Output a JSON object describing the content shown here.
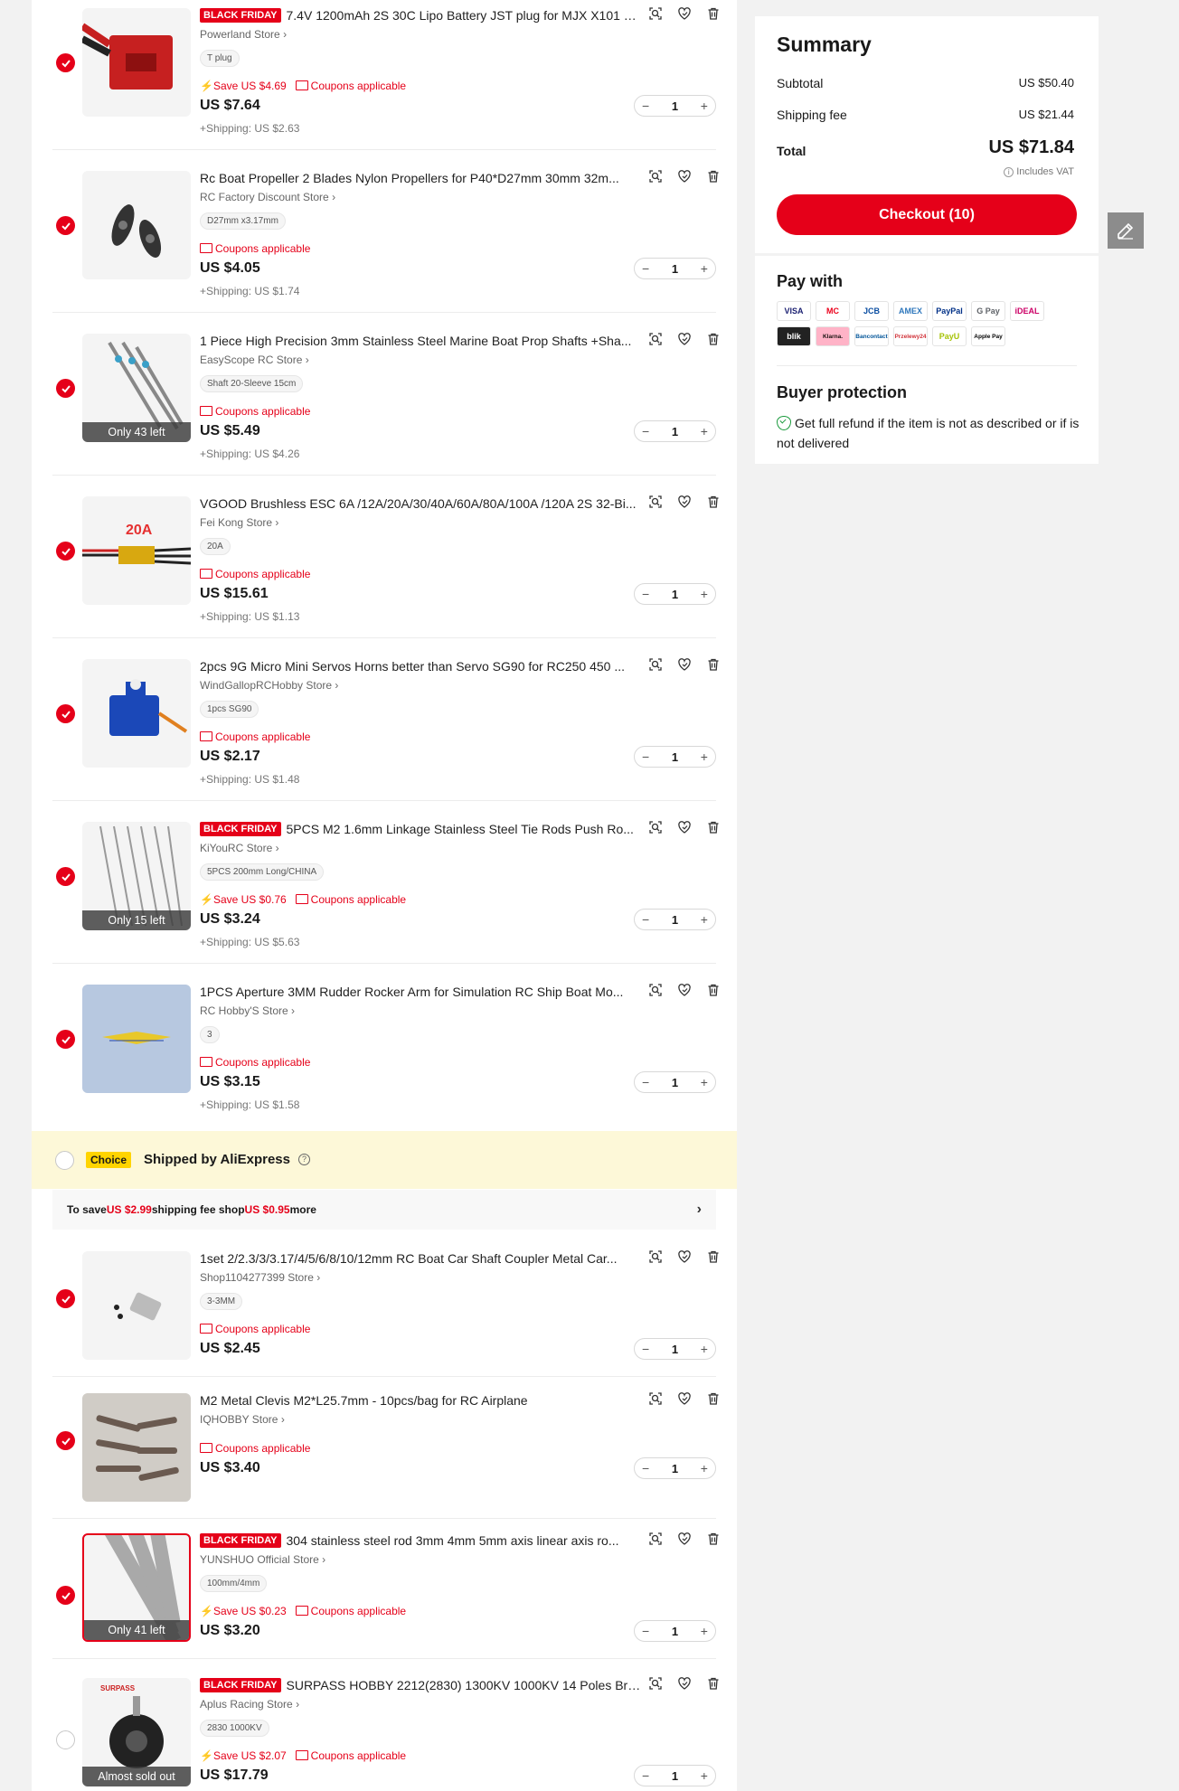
{
  "items": [
    {
      "badge": "BLACK FRIDAY",
      "title": "7.4V 1200mAh 2S 30C Lipo Battery JST plug for MJX X101 X...",
      "store": "Powerland Store",
      "variant": "T plug",
      "save": "Save US $4.69",
      "coupon": "Coupons applicable",
      "price": "US $7.64",
      "shipping": "+Shipping: US $2.63",
      "qty": "1",
      "stock": ""
    },
    {
      "badge": "",
      "title": "Rc Boat Propeller 2 Blades Nylon Propellers for P40*D27mm 30mm 32m...",
      "store": "RC Factory Discount Store",
      "variant": "D27mm x3.17mm",
      "save": "",
      "coupon": "Coupons applicable",
      "price": "US $4.05",
      "shipping": "+Shipping: US $1.74",
      "qty": "1",
      "stock": ""
    },
    {
      "badge": "",
      "title": "1 Piece High Precision 3mm Stainless Steel Marine Boat Prop Shafts +Sha...",
      "store": "EasyScope RC Store",
      "variant": "Shaft 20-Sleeve 15cm",
      "save": "",
      "coupon": "Coupons applicable",
      "price": "US $5.49",
      "shipping": "+Shipping: US $4.26",
      "qty": "1",
      "stock": "Only 43 left"
    },
    {
      "badge": "",
      "title": "VGOOD Brushless ESC 6A /12A/20A/30/40A/60A/80A/100A /120A 2S 32-Bi...",
      "store": "Fei Kong Store",
      "variant": "20A",
      "save": "",
      "coupon": "Coupons applicable",
      "price": "US $15.61",
      "shipping": "+Shipping: US $1.13",
      "qty": "1",
      "stock": ""
    },
    {
      "badge": "",
      "title": "2pcs 9G Micro Mini Servos Horns better than Servo SG90 for RC250 450 ...",
      "store": "WindGallopRCHobby Store",
      "variant": "1pcs SG90",
      "save": "",
      "coupon": "Coupons applicable",
      "price": "US $2.17",
      "shipping": "+Shipping: US $1.48",
      "qty": "1",
      "stock": ""
    },
    {
      "badge": "BLACK FRIDAY",
      "title": "5PCS M2 1.6mm Linkage Stainless Steel Tie Rods Push Ro...",
      "store": "KiYouRC Store",
      "variant": "5PCS 200mm Long/CHINA",
      "save": "Save US $0.76",
      "coupon": "Coupons applicable",
      "price": "US $3.24",
      "shipping": "+Shipping: US $5.63",
      "qty": "1",
      "stock": "Only 15 left"
    },
    {
      "badge": "",
      "title": "1PCS Aperture 3MM Rudder Rocker Arm for Simulation RC Ship Boat Mo...",
      "store": "RC Hobby'S Store",
      "variant": "3",
      "save": "",
      "coupon": "Coupons applicable",
      "price": "US $3.15",
      "shipping": "+Shipping: US $1.58",
      "qty": "1",
      "stock": ""
    }
  ],
  "choice": {
    "badge": "Choice",
    "label": "Shipped by AliExpress",
    "save_prefix": "To save ",
    "save_amount": "US $2.99",
    "save_middle": " shipping fee shop ",
    "save_more": "US $0.95",
    "save_suffix": " more"
  },
  "items2": [
    {
      "badge": "",
      "title": "1set 2/2.3/3/3.17/4/5/6/8/10/12mm RC Boat Car Shaft Coupler Metal Car...",
      "store": "Shop1104277399 Store",
      "variant": "3-3MM",
      "save": "",
      "coupon": "Coupons applicable",
      "price": "US $2.45",
      "shipping": "",
      "qty": "1",
      "stock": ""
    },
    {
      "badge": "",
      "title": "M2 Metal Clevis M2*L25.7mm - 10pcs/bag for RC Airplane",
      "store": "IQHOBBY Store",
      "variant": "",
      "save": "",
      "coupon": "Coupons applicable",
      "price": "US $3.40",
      "shipping": "",
      "qty": "1",
      "stock": ""
    },
    {
      "badge": "BLACK FRIDAY",
      "title": "304 stainless steel rod 3mm 4mm 5mm axis linear axis ro...",
      "store": "YUNSHUO Official Store",
      "variant": "100mm/4mm",
      "save": "Save US $0.23",
      "coupon": "Coupons applicable",
      "price": "US $3.20",
      "shipping": "",
      "qty": "1",
      "stock": "Only 41 left"
    },
    {
      "badge": "BLACK FRIDAY",
      "title": "SURPASS HOBBY 2212(2830) 1300KV 1000KV 14 Poles Bru...",
      "store": "Aplus Racing Store",
      "variant": "2830 1000KV",
      "save": "Save US $2.07",
      "coupon": "Coupons applicable",
      "price": "US $17.79",
      "shipping": "",
      "qty": "1",
      "stock": "Almost sold out"
    }
  ],
  "summary": {
    "title": "Summary",
    "subtotal_label": "Subtotal",
    "subtotal": "US $50.40",
    "shipping_label": "Shipping fee",
    "shipping": "US $21.44",
    "total_label": "Total",
    "total": "US $71.84",
    "vat": "Includes VAT",
    "checkout": "Checkout (10)"
  },
  "pay": {
    "title": "Pay with",
    "methods": [
      "VISA",
      "MC",
      "JCB",
      "AMEX",
      "PayPal",
      "G Pay",
      "iDEAL",
      "blik",
      "Klarna.",
      "Bancontact",
      "Przelewy24",
      "PayU",
      "Apple Pay"
    ]
  },
  "protection": {
    "title": "Buyer protection",
    "text": "Get full refund if the item is not as described or if is not delivered"
  },
  "colors": {
    "accent": "#e50019",
    "choice_bg": "#fdf8d8",
    "choice_badge": "#ffd400"
  }
}
